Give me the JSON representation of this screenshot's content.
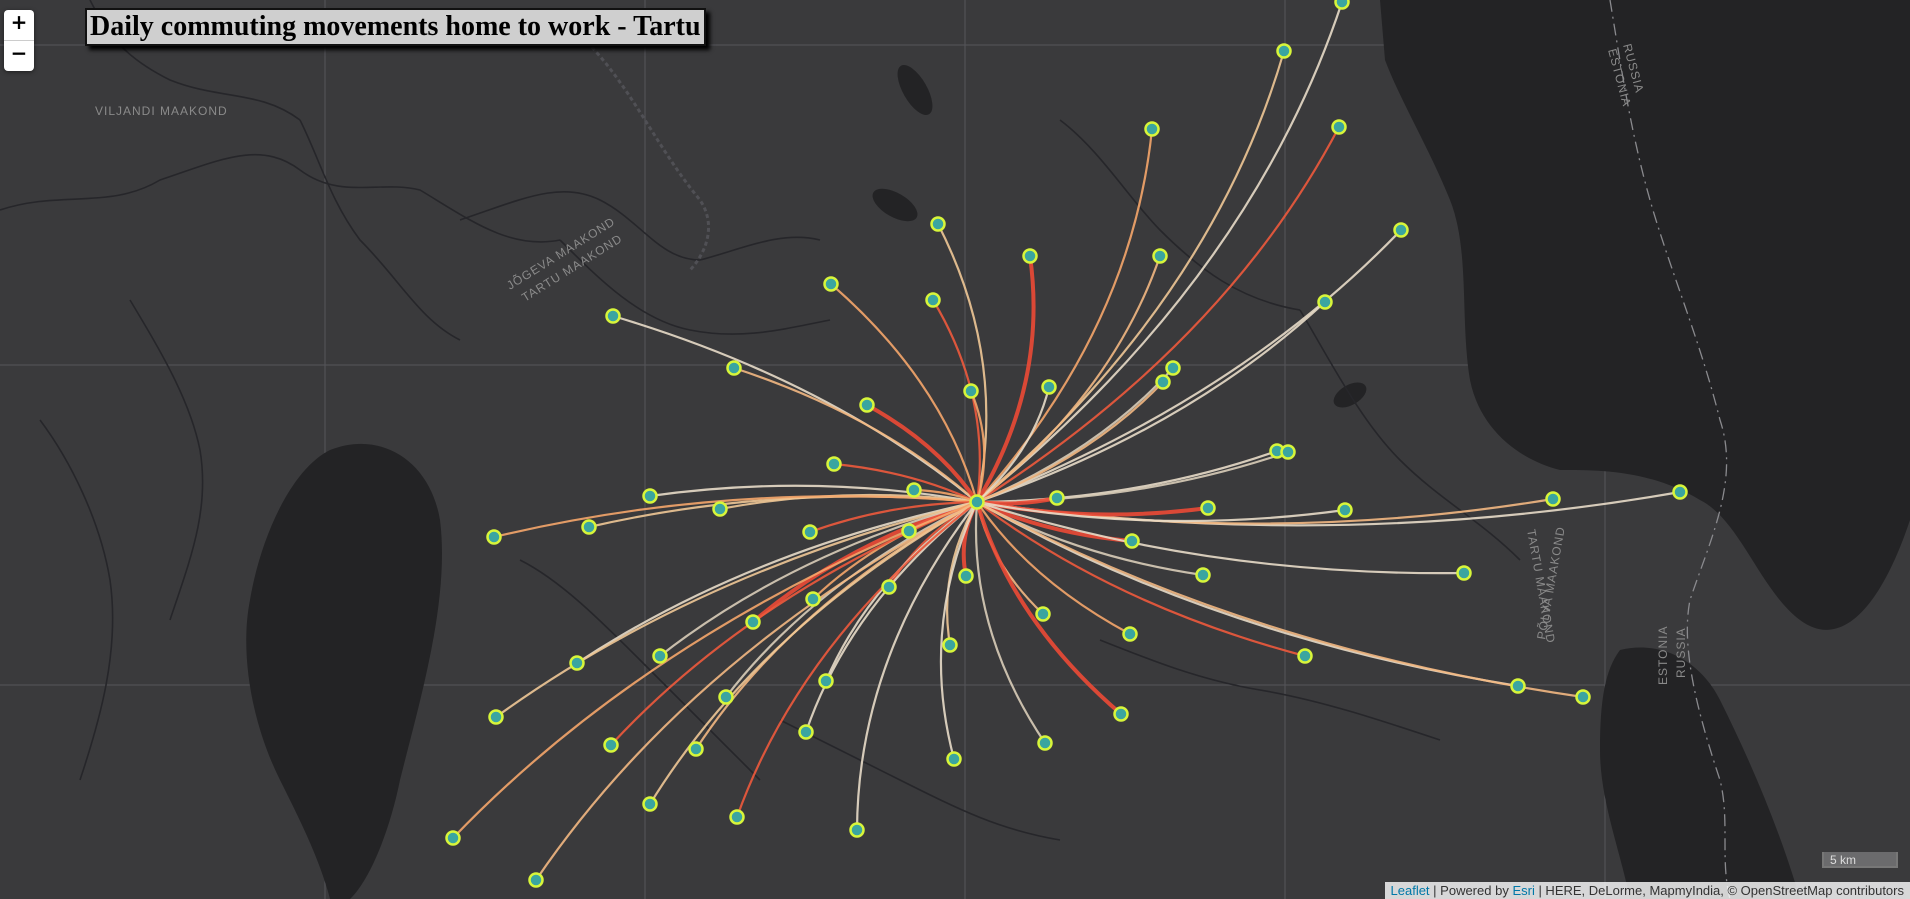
{
  "title": "Daily commuting movements home to work - Tartu",
  "zoom": {
    "in_label": "+",
    "out_label": "−"
  },
  "scale_label": "5 km",
  "attribution": {
    "leaflet": "Leaflet",
    "sep1": " | Powered by ",
    "esri": "Esri",
    "rest": " | HERE, DeLorme, MapmyIndia, © OpenStreetMap contributors"
  },
  "map_labels": [
    {
      "text": "VILJANDI MAAKOND"
    },
    {
      "text": "JÕGEVA MAAKOND"
    },
    {
      "text": "TARTU MAAKOND"
    },
    {
      "text": "RUSSIA"
    },
    {
      "text": "ESTONIA"
    },
    {
      "text": "TARTU MAAKOND"
    },
    {
      "text": "PÕLVA MAAKOND"
    },
    {
      "text": "ESTONIA"
    },
    {
      "text": "RUSSIA"
    }
  ],
  "colors": {
    "land": "#3a3a3c",
    "water": "#232325",
    "node_fill": "#3aa5a0",
    "node_stroke": "#d7f53a"
  }
}
